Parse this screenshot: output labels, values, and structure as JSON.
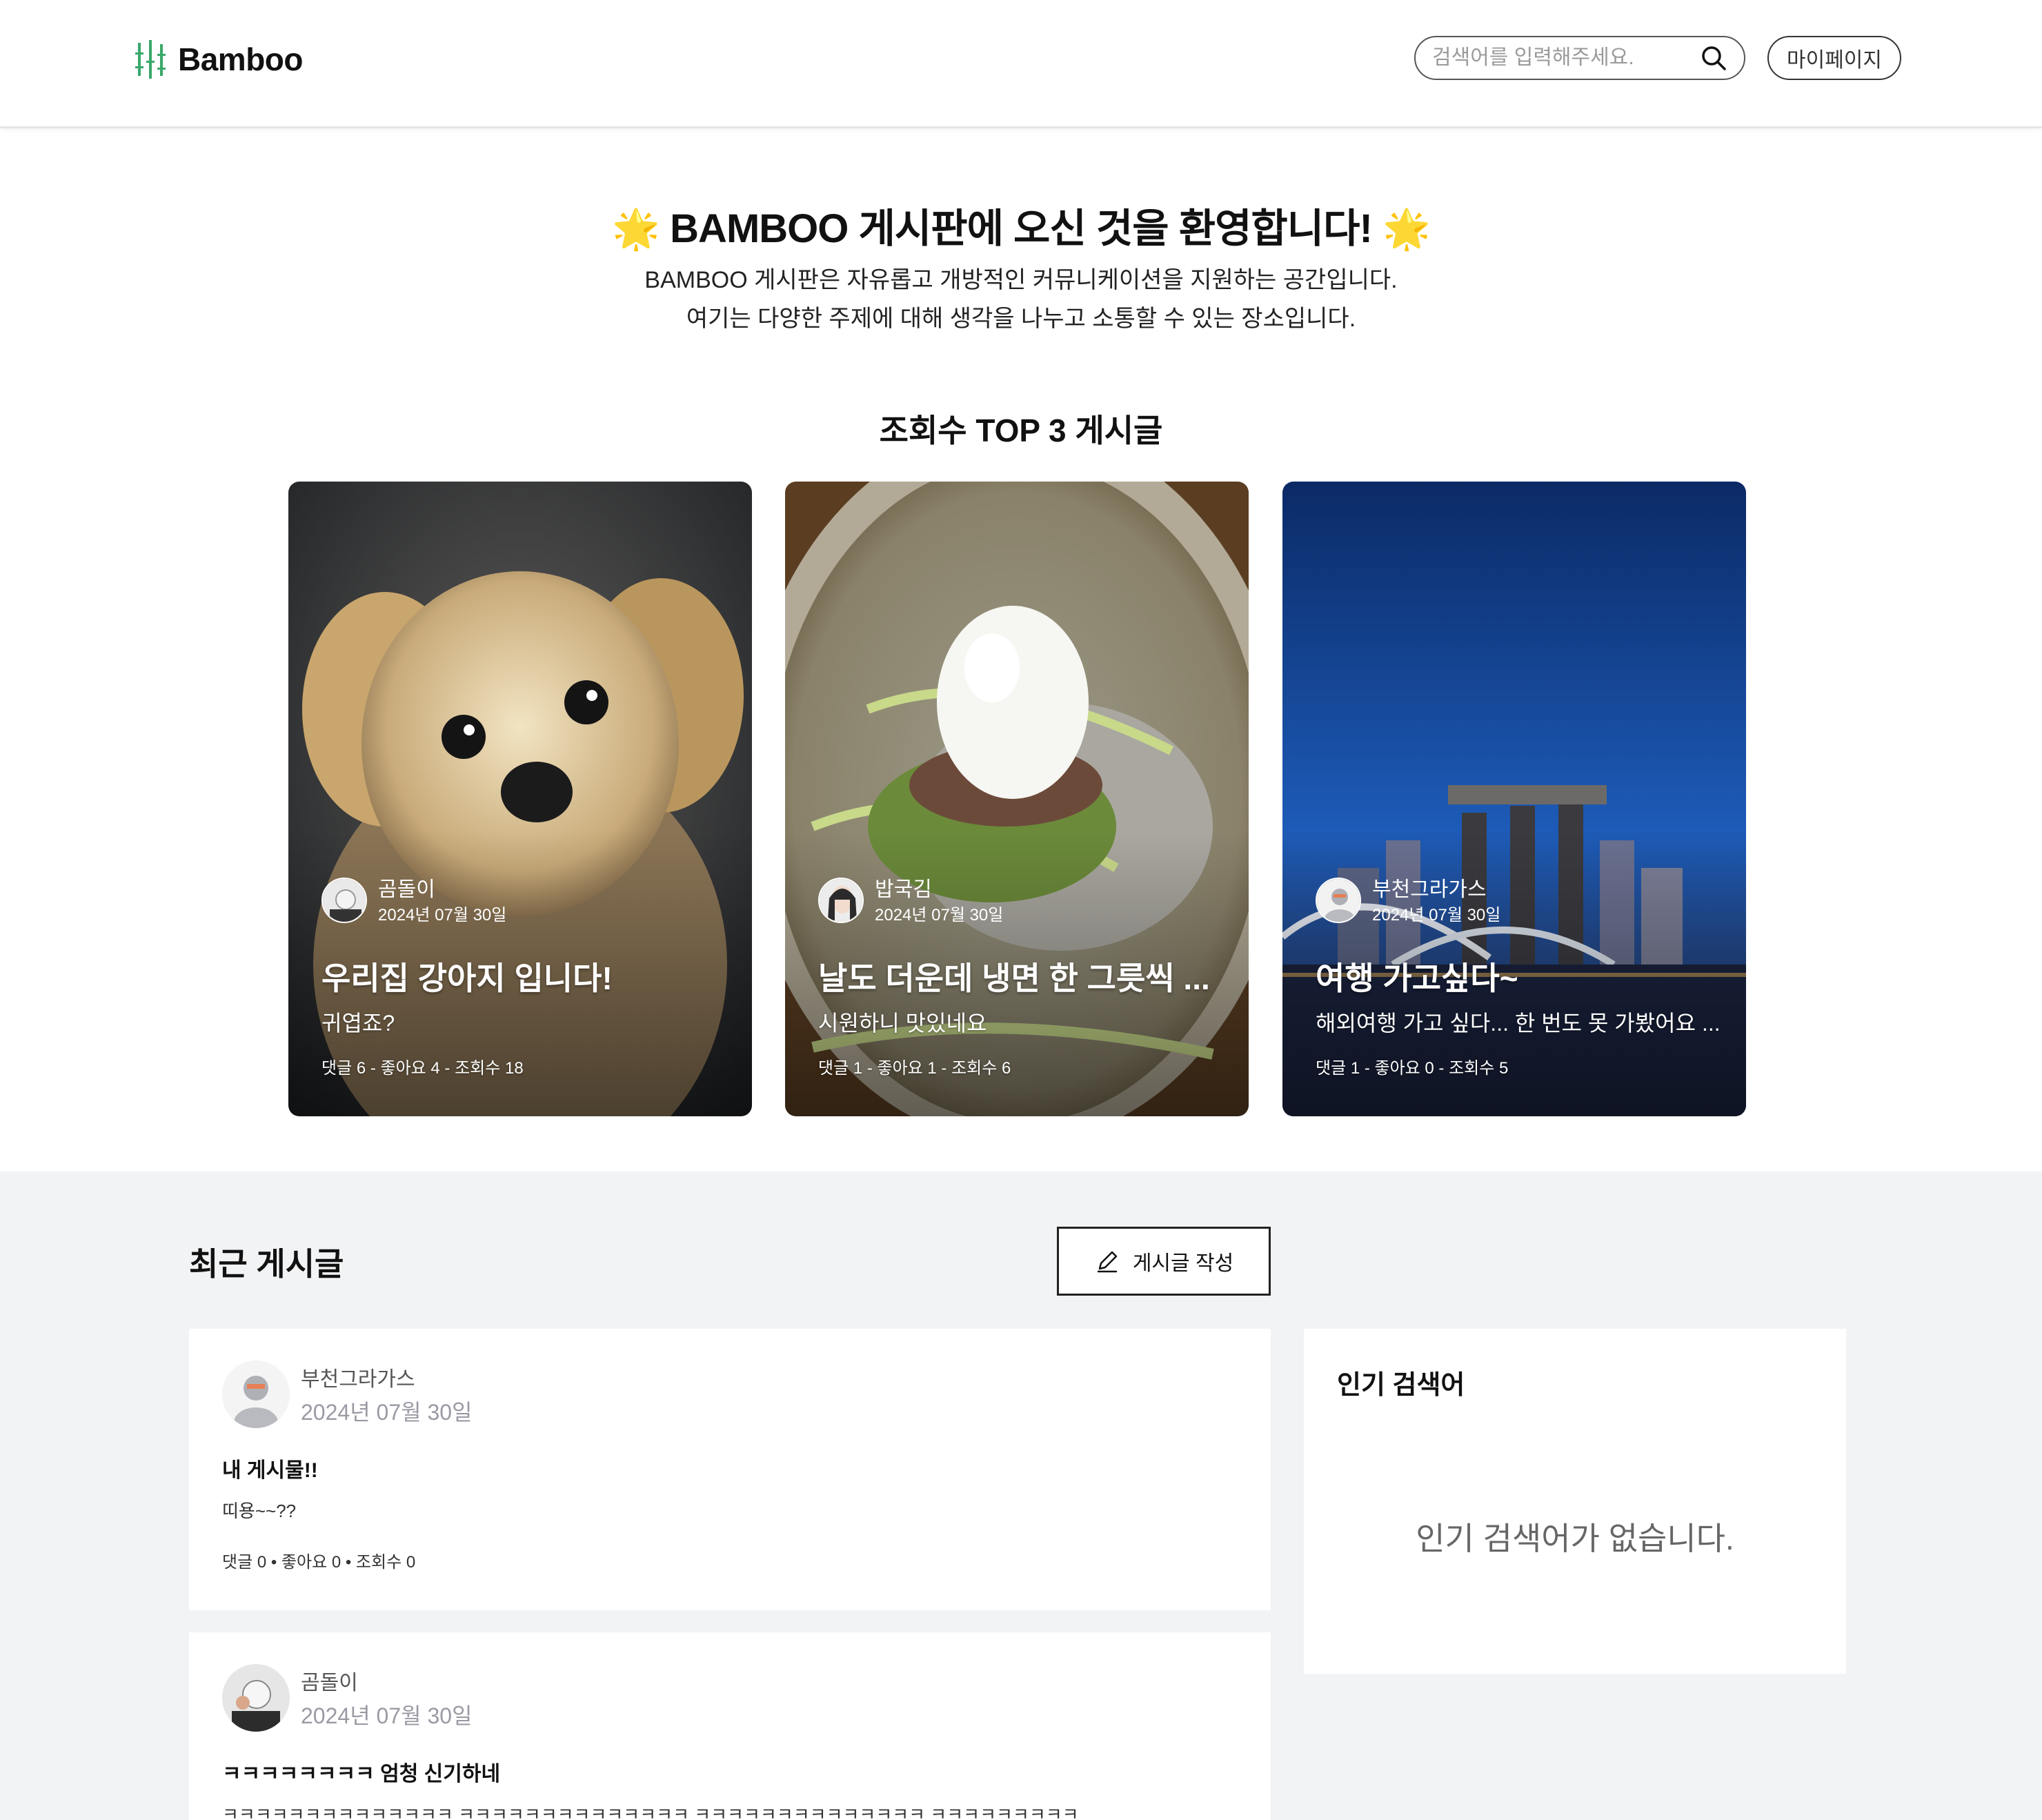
{
  "header": {
    "logo_text": "Bamboo",
    "search_placeholder": "검색어를 입력해주세요.",
    "mypage_label": "마이페이지"
  },
  "hero": {
    "star": "🌟",
    "title": "BAMBOO 게시판에 오신 것을 환영합니다!",
    "desc_line1": "BAMBOO 게시판은 자유롭고 개방적인 커뮤니케이션을 지원하는 공간입니다.",
    "desc_line2": "여기는 다양한 주제에 대해 생각을 나누고 소통할 수 있는 장소입니다."
  },
  "top3": {
    "title": "조회수 TOP 3 게시글",
    "cards": [
      {
        "author": "곰돌이",
        "date": "2024년 07월 30일",
        "title": "우리집 강아지 입니다!",
        "body": "귀엽죠?",
        "stats": "댓글 6 - 좋아요 4 - 조회수 18"
      },
      {
        "author": "밥국김",
        "date": "2024년 07월 30일",
        "title": "날도 더운데 냉면 한 그릇씩 ...",
        "body": "시원하니 맛있네요",
        "stats": "댓글 1 - 좋아요 1 - 조회수 6"
      },
      {
        "author": "부천그라가스",
        "date": "2024년 07월 30일",
        "title": "여행 가고싶다~",
        "body": "해외여행 가고 싶다... 한 번도 못 가봤어요 ...",
        "stats": "댓글 1 - 좋아요 0 - 조회수 5"
      }
    ]
  },
  "recent": {
    "title": "최근 게시글",
    "write_label": "게시글 작성",
    "posts": [
      {
        "author": "부천그라가스",
        "date": "2024년 07월 30일",
        "title": "내 게시물!!",
        "body": "띠용~~??",
        "stats": "댓글 0 • 좋아요 0 • 조회수 0"
      },
      {
        "author": "곰돌이",
        "date": "2024년 07월 30일",
        "title": "ㅋㅋㅋㅋㅋㅋㅋㅋ 엄청 신기하네",
        "body": "ㅋㅋㅋㅋㅋㅋㅋㅋㅋㅋㅋㅋㅋㅋ ㅋㅋㅋㅋㅋㅋㅋㅋㅋㅋㅋㅋㅋㅋ ㅋㅋㅋㅋㅋㅋㅋㅋㅋㅋㅋㅋㅋㅋ ㅋㅋㅋㅋㅋㅋㅋㅋㅋ",
        "stats": ""
      }
    ]
  },
  "popular": {
    "title": "인기 검색어",
    "empty": "인기 검색어가 없습니다."
  },
  "colors": {
    "brand": "#3aa86b",
    "lower_bg": "#f2f3f5"
  },
  "icons": [
    "bamboo-logo-icon",
    "search-icon",
    "pencil-icon"
  ]
}
